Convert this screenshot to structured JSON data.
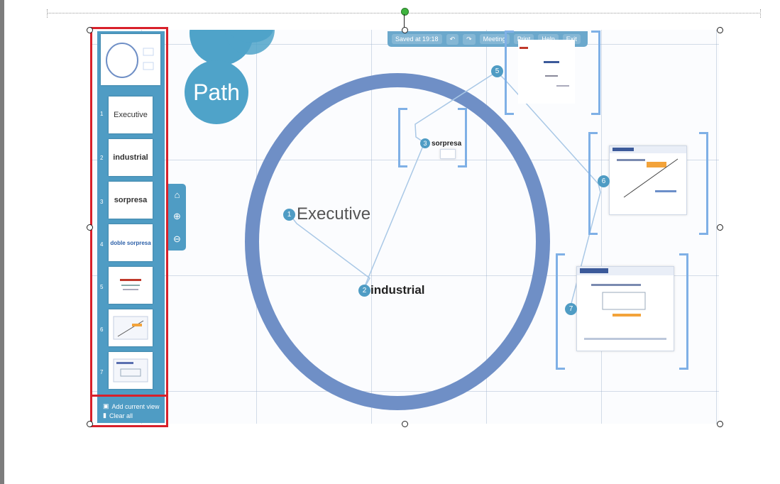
{
  "toolbar": {
    "saved": "Saved at 19:18",
    "meeting": "Meeting",
    "print": "Print",
    "help": "Help",
    "exit": "Exit"
  },
  "title": "Path",
  "sidebar": {
    "items": [
      {
        "num": "1",
        "label": "Executive"
      },
      {
        "num": "2",
        "label": "industrial"
      },
      {
        "num": "3",
        "label": "sorpresa"
      },
      {
        "num": "4",
        "label": "doble sorpresa"
      },
      {
        "num": "5",
        "label": ""
      },
      {
        "num": "6",
        "label": ""
      },
      {
        "num": "7",
        "label": ""
      }
    ],
    "add_view": "Add current view",
    "clear_all": "Clear all"
  },
  "canvas": {
    "executive": "Executive",
    "industrial": "industrial",
    "sorpresa": "sorpresa",
    "marker_numbers": [
      "1",
      "2",
      "3",
      "5",
      "6",
      "7"
    ]
  }
}
